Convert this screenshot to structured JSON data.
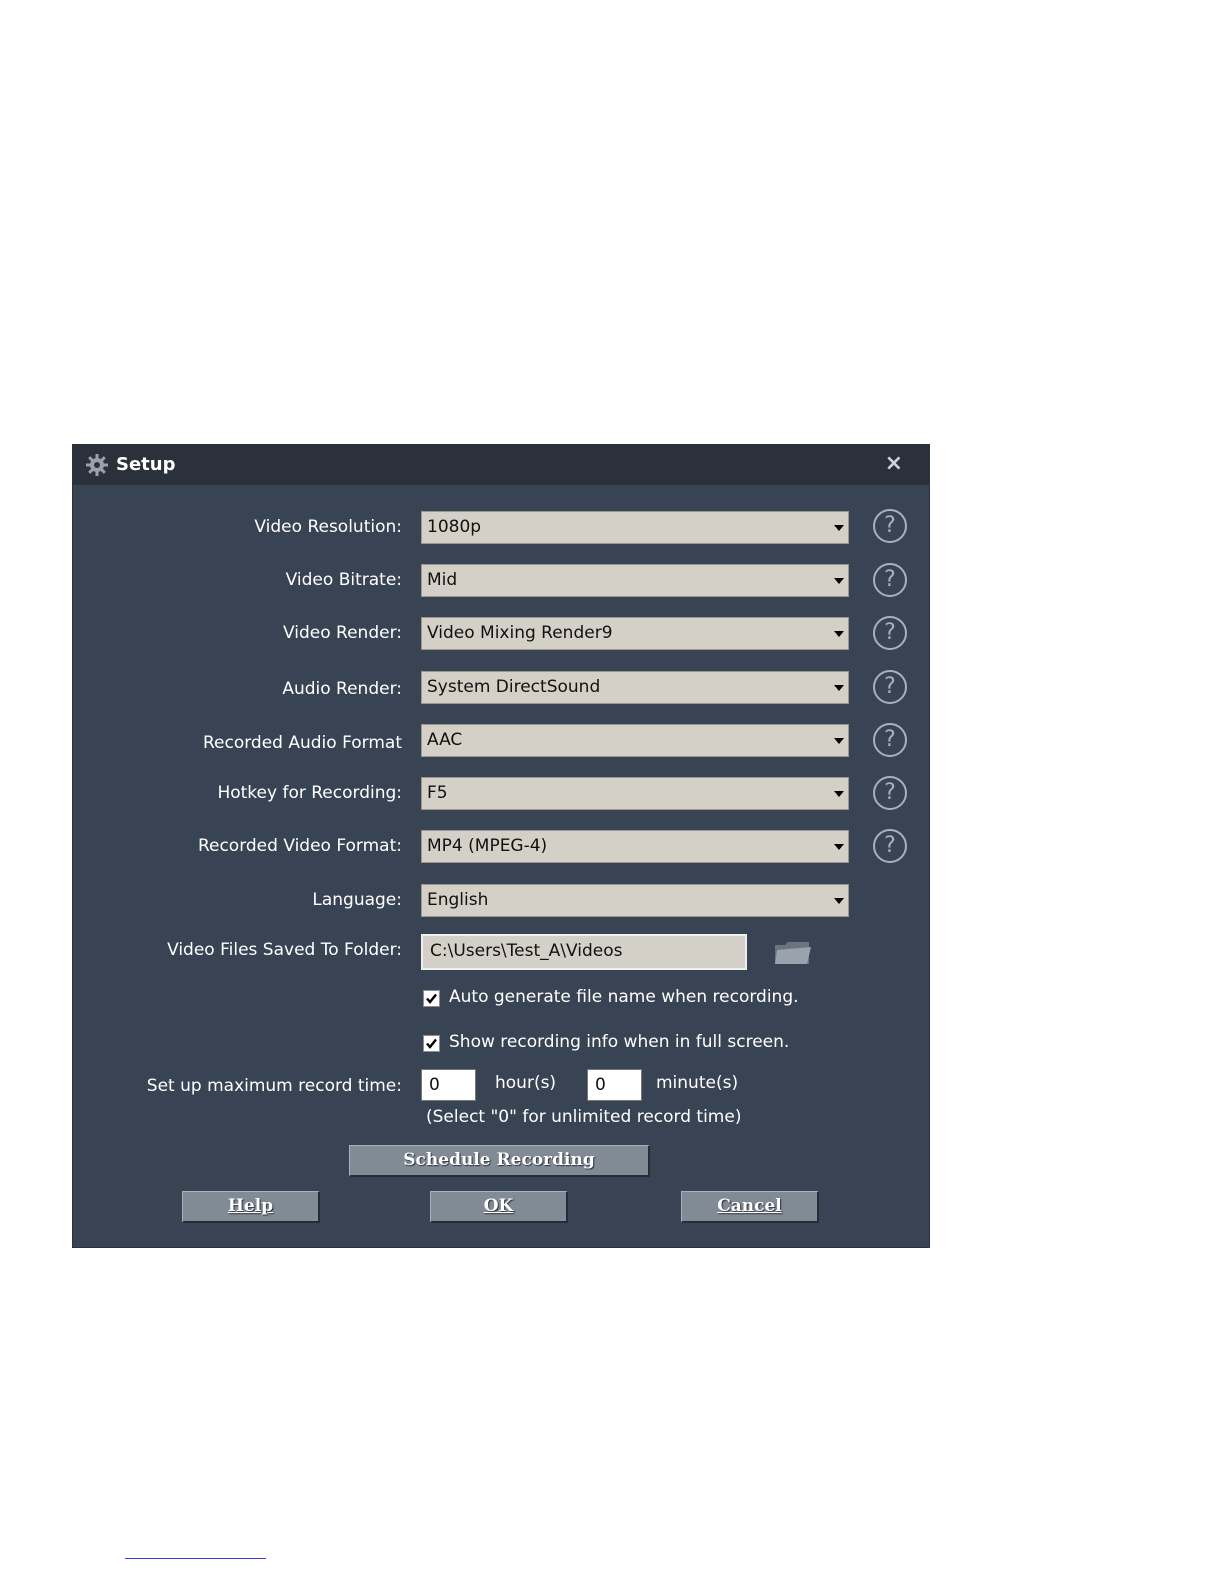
{
  "dialog": {
    "title": "Setup",
    "close_label": "×"
  },
  "rows": [
    {
      "label": "Video Resolution:",
      "value": "1080p"
    },
    {
      "label": "Video Bitrate:",
      "value": "Mid"
    },
    {
      "label": "Video Render:",
      "value": "Video Mixing Render9"
    },
    {
      "label": "Audio Render:",
      "value": "System DirectSound"
    },
    {
      "label": "Recorded Audio Format",
      "value": "AAC"
    },
    {
      "label": "Hotkey for Recording:",
      "value": "F5"
    },
    {
      "label": "Recorded Video Format:",
      "value": "MP4 (MPEG-4)"
    },
    {
      "label": "Language:",
      "value": "English"
    }
  ],
  "help_glyph": "?",
  "folder": {
    "label": "Video Files Saved To Folder:",
    "value": "C:\\Users\\Test_A\\Videos"
  },
  "checkboxes": [
    {
      "label": "Auto generate file name when recording.",
      "checked": true
    },
    {
      "label": "Show recording info when in full screen.",
      "checked": true
    }
  ],
  "max_time": {
    "label": "Set up maximum record time:",
    "hours": "0",
    "hours_unit": "hour(s)",
    "minutes": "0",
    "minutes_unit": "minute(s)",
    "hint": "(Select \"0\" for unlimited record time)"
  },
  "buttons": {
    "schedule": "Schedule Recording",
    "help": "Help",
    "ok": "OK",
    "cancel": "Cancel"
  },
  "icons": {
    "title": "gear-icon",
    "close": "close-icon",
    "help": "question-circle-icon",
    "folder": "folder-icon",
    "dropdown": "dropdown-arrow-icon",
    "check": "checkmark-icon"
  },
  "colors": {
    "dialog_bg": "#384454",
    "titlebar_bg": "#2b313b",
    "field_bg": "#d4d0c8",
    "button_bg": "#818b96"
  }
}
